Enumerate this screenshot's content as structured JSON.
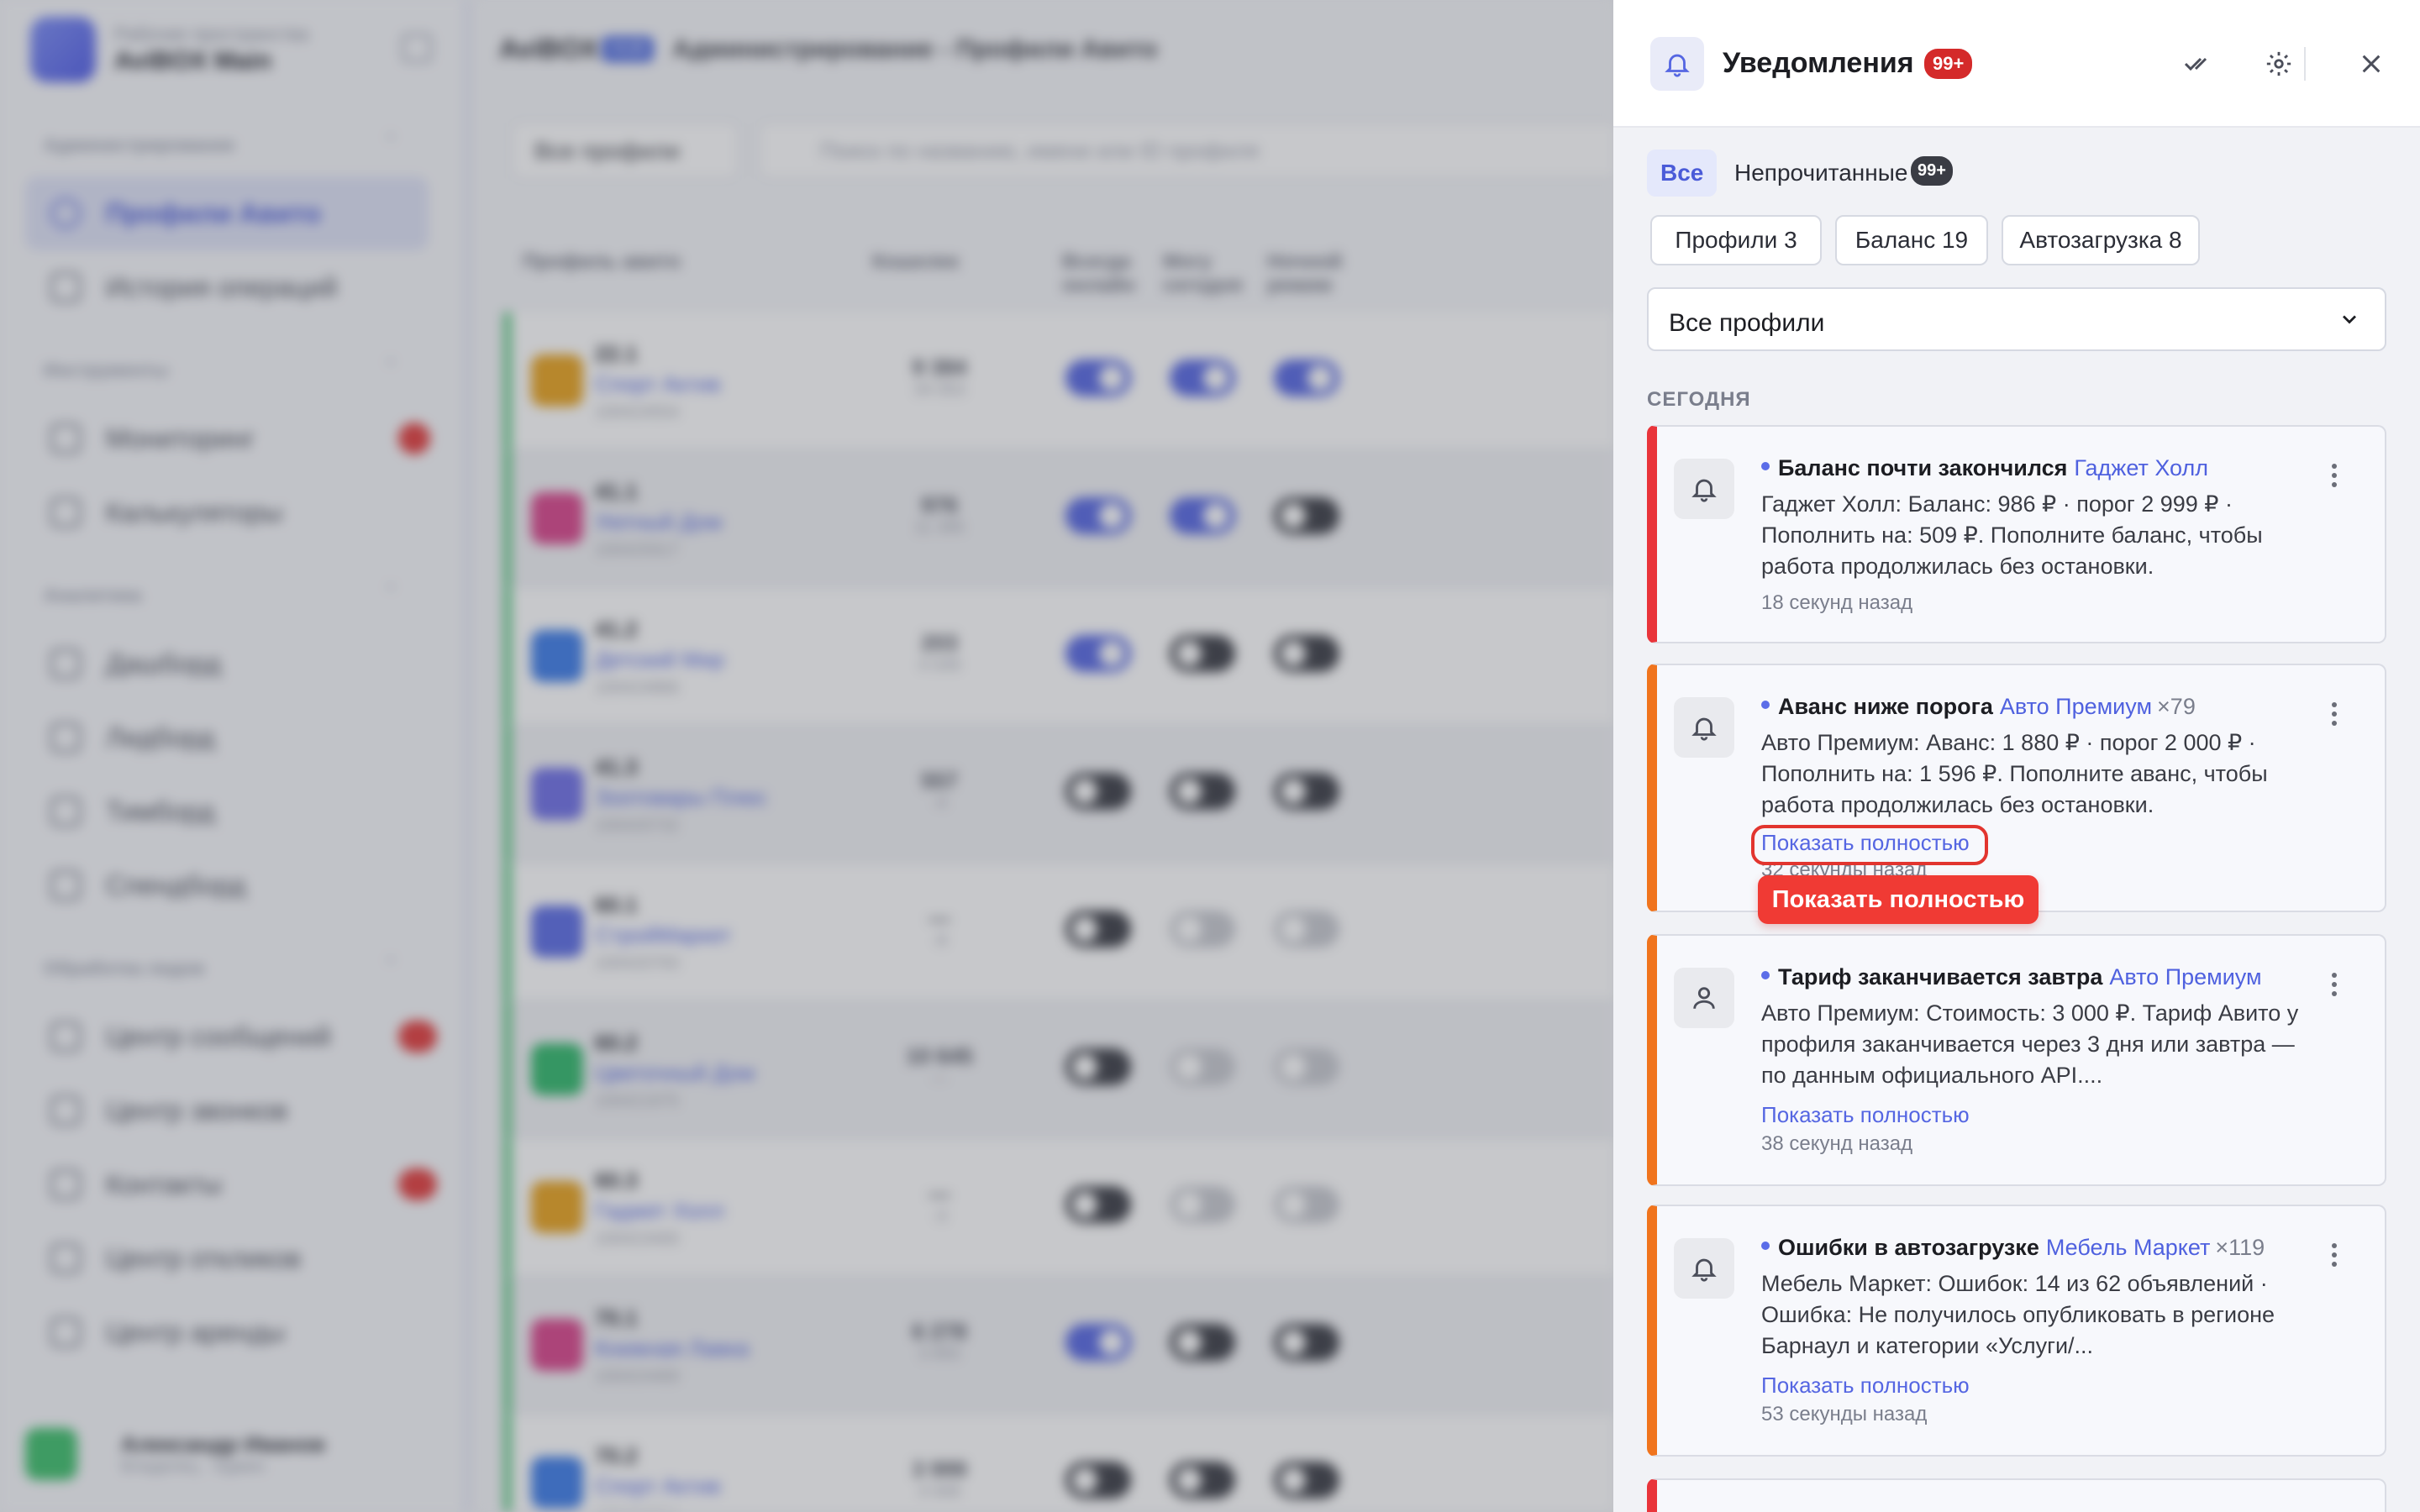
{
  "workspace": {
    "label": "Рабочие пространства",
    "name": "AviBOX Main"
  },
  "sidebar": {
    "sections": [
      {
        "title": "Администрирование",
        "items": [
          {
            "label": "Профили Авито"
          },
          {
            "label": "История операций"
          }
        ]
      },
      {
        "title": "Инструменты",
        "items": [
          {
            "label": "Мониторинг"
          },
          {
            "label": "Калькуляторы"
          }
        ]
      },
      {
        "title": "Аналитика",
        "items": [
          {
            "label": "Дашборд"
          },
          {
            "label": "Лидборд"
          },
          {
            "label": "Тимборд"
          },
          {
            "label": "Спендборд"
          }
        ]
      },
      {
        "title": "Обработка лидов",
        "items": [
          {
            "label": "Центр сообщений"
          },
          {
            "label": "Центр звонков"
          },
          {
            "label": "Контакты"
          },
          {
            "label": "Центр откликов"
          },
          {
            "label": "Центр аренды"
          }
        ]
      }
    ],
    "user": {
      "name": "Александр Иванов",
      "role": "Владелец",
      "tag": "Админ"
    }
  },
  "main": {
    "logo": "AviBOX",
    "logo_badge": "HUB",
    "title": "Администрирование - Профили Авито",
    "filter": "Все профили",
    "search_placeholder": "Поиск по названию, имени или ID профиля",
    "columns": [
      "Профиль авито",
      "Кошелек",
      "Всегда онлайн",
      "Могу сегодня",
      "Ночной режим"
    ],
    "rows": [
      {
        "num": "22.1",
        "name": "Спорт Актив",
        "id": "100424554",
        "wallet": "9 384",
        "wallet_sub": "34 053",
        "color": "#e8a21c"
      },
      {
        "num": "41.1",
        "name": "Уютный Дом",
        "id": "100425917",
        "wallet": "976",
        "wallet_sub": "11 395",
        "color": "#d9438a"
      },
      {
        "num": "41.2",
        "name": "Детский Мир",
        "id": "100424866",
        "wallet": "203",
        "wallet_sub": "4 549",
        "color": "#3b7be8"
      },
      {
        "num": "41.3",
        "name": "Зоотовары Плюс",
        "id": "100420732",
        "wallet": "557",
        "wallet_sub": "-4",
        "color": "#6d6ee6"
      },
      {
        "num": "60.1",
        "name": "СтройМаркет",
        "id": "100420793",
        "wallet": "—",
        "wallet_sub": "-9",
        "color": "#5a6be4"
      },
      {
        "num": "60.2",
        "name": "Цветочный Дом",
        "id": "100421875",
        "wallet": "10 645",
        "wallet_sub": "—",
        "color": "#2fb86a"
      },
      {
        "num": "60.3",
        "name": "Гаджет Холл",
        "id": "100423400",
        "wallet": "—",
        "wallet_sub": "-3",
        "color": "#e8a21c"
      },
      {
        "num": "70.1",
        "name": "Книжная Лавка",
        "id": "100424469",
        "wallet": "6 278",
        "wallet_sub": "3 855",
        "color": "#d9438a"
      },
      {
        "num": "70.2",
        "name": "Спорт Актив",
        "id": "100424554",
        "wallet": "3 999",
        "wallet_sub": "4 948",
        "color": "#3b7be8"
      }
    ]
  },
  "panel": {
    "title": "Уведомления",
    "count": "99+",
    "tabs": {
      "all": "Все",
      "unread": "Непрочитанные",
      "unread_count": "99+"
    },
    "chips": [
      "Профили 3",
      "Баланс 19",
      "Автозагрузка 8"
    ],
    "profile_select": "Все профили",
    "day_label": "СЕГОДНЯ",
    "cards": [
      {
        "title": "Баланс почти закончился",
        "profile": "Гаджет Холл",
        "mult": "",
        "body": "Гаджет Холл: Баланс: 986 ₽ · порог 2 999 ₽ · Пополнить на: 509 ₽. Пополните баланс, чтобы работа продолжилась без остановки.",
        "show": "",
        "time": "18 секунд назад",
        "icon": "bell-icon"
      },
      {
        "title": "Аванс ниже порога",
        "profile": "Авто Премиум",
        "mult": "×79",
        "body": "Авто Премиум: Аванс: 1 880 ₽ · порог 2 000 ₽ · Пополнить на: 1 596 ₽. Пополните аванс, чтобы работа продолжилась без остановки.",
        "show": "Показать полностью",
        "time": "32 секунды назад",
        "icon": "bell-icon"
      },
      {
        "title": "Тариф заканчивается завтра",
        "profile": "Авто Премиум",
        "mult": "",
        "body": "Авто Премиум: Стоимость: 3 000 ₽. Тариф Авито у профиля заканчивается через 3 дня или завтра — по данным официального API....",
        "show": "Показать полностью",
        "time": "38 секунд назад",
        "icon": "user-icon"
      },
      {
        "title": "Ошибки в автозагрузке",
        "profile": "Мебель Маркет",
        "mult": "×119",
        "body": "Мебель Маркет: Ошибок: 14 из 62 объявлений · Ошибка: Не получилось опубликовать в регионе Барнаул и категории «Услуги/...",
        "show": "Показать полностью",
        "time": "53 секунды назад",
        "icon": "bell-icon"
      }
    ],
    "tooltip": "Показать полностью"
  }
}
